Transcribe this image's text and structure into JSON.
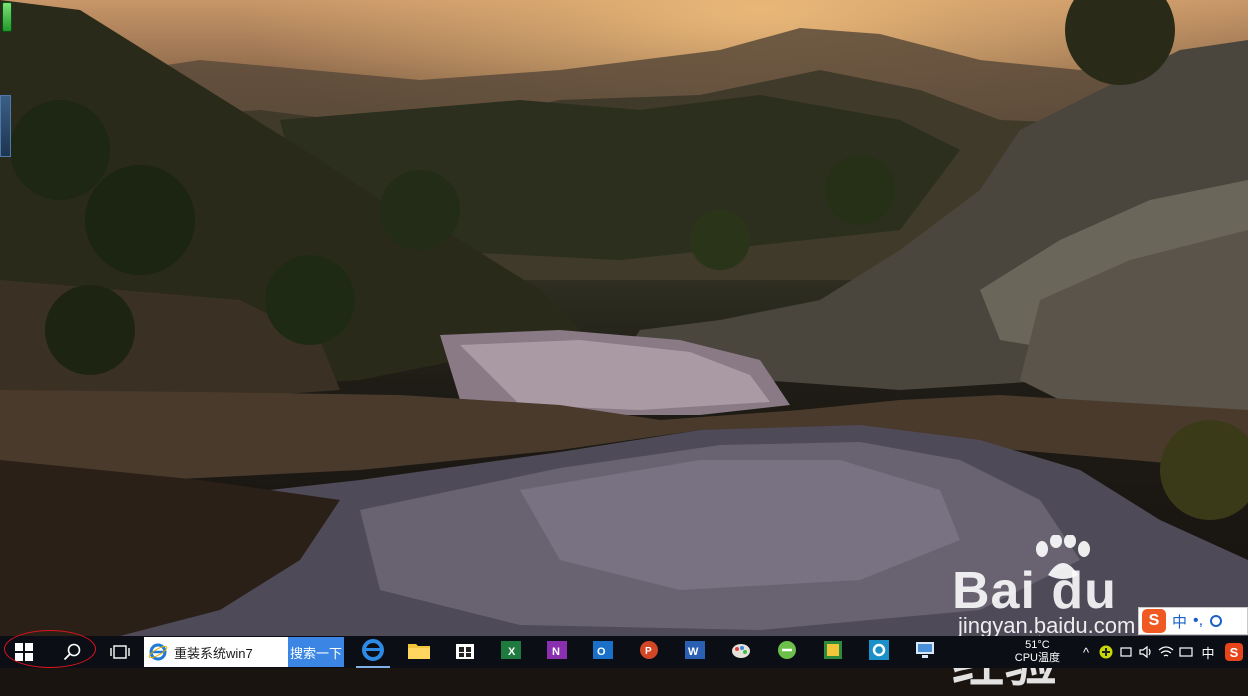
{
  "search": {
    "value": "重装系统win7",
    "button_label": "搜索一下"
  },
  "taskbar": {
    "apps": [
      {
        "name": "edge-icon"
      },
      {
        "name": "file-explorer-icon"
      },
      {
        "name": "store-icon"
      },
      {
        "name": "excel-icon"
      },
      {
        "name": "onenote-icon"
      },
      {
        "name": "outlook-icon"
      },
      {
        "name": "powerpoint-icon"
      },
      {
        "name": "word-icon"
      },
      {
        "name": "paint-icon"
      },
      {
        "name": "green-app-icon"
      },
      {
        "name": "sheet-app-icon"
      },
      {
        "name": "settings-icon"
      },
      {
        "name": "remote-desktop-icon"
      }
    ]
  },
  "tray": {
    "temp_value": "51°C",
    "temp_label": "CPU温度",
    "ime_label": "中"
  },
  "ime_bar": {
    "s_label": "S",
    "lang": "中",
    "punct": "•,"
  },
  "watermark": {
    "logo": "Bai  du 经验",
    "url": "jingyan.baidu.com"
  },
  "colors": {
    "taskbar": "#0b0e14",
    "search_go": "#3b86e4",
    "annotation_circle": "#e1141d"
  }
}
